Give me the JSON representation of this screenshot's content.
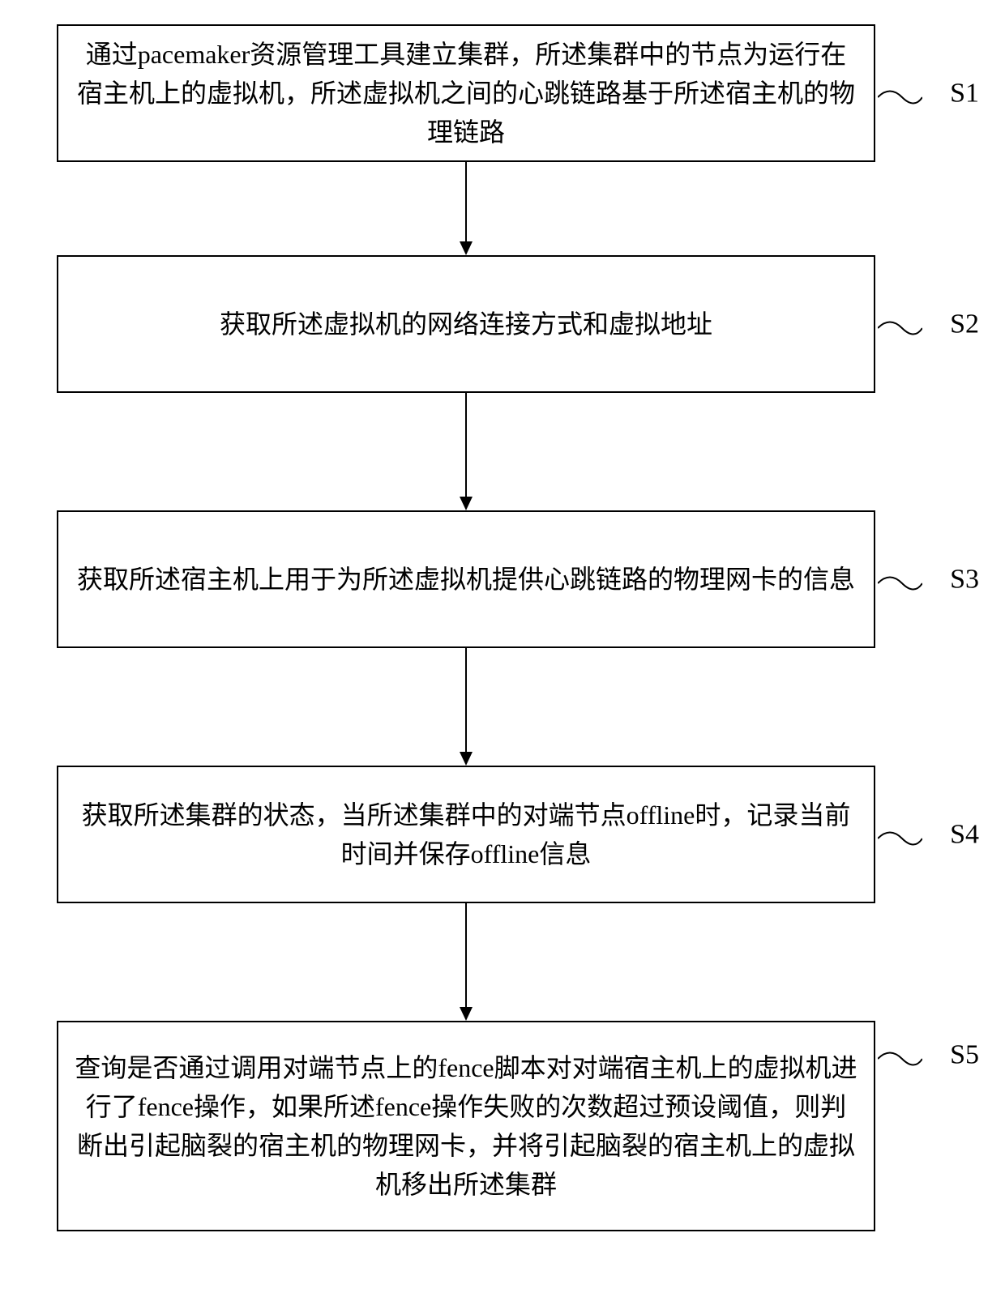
{
  "flowchart": {
    "steps": [
      {
        "id": "S1",
        "text": "通过pacemaker资源管理工具建立集群，所述集群中的节点为运行在宿主机上的虚拟机，所述虚拟机之间的心跳链路基于所述宿主机的物理链路"
      },
      {
        "id": "S2",
        "text": "获取所述虚拟机的网络连接方式和虚拟地址"
      },
      {
        "id": "S3",
        "text": "获取所述宿主机上用于为所述虚拟机提供心跳链路的物理网卡的信息"
      },
      {
        "id": "S4",
        "text": "获取所述集群的状态，当所述集群中的对端节点offline时，记录当前时间并保存offline信息"
      },
      {
        "id": "S5",
        "text": "查询是否通过调用对端节点上的fence脚本对对端宿主机上的虚拟机进行了fence操作，如果所述fence操作失败的次数超过预设阈值，则判断出引起脑裂的宿主机的物理网卡，并将引起脑裂的宿主机上的虚拟机移出所述集群"
      }
    ]
  }
}
